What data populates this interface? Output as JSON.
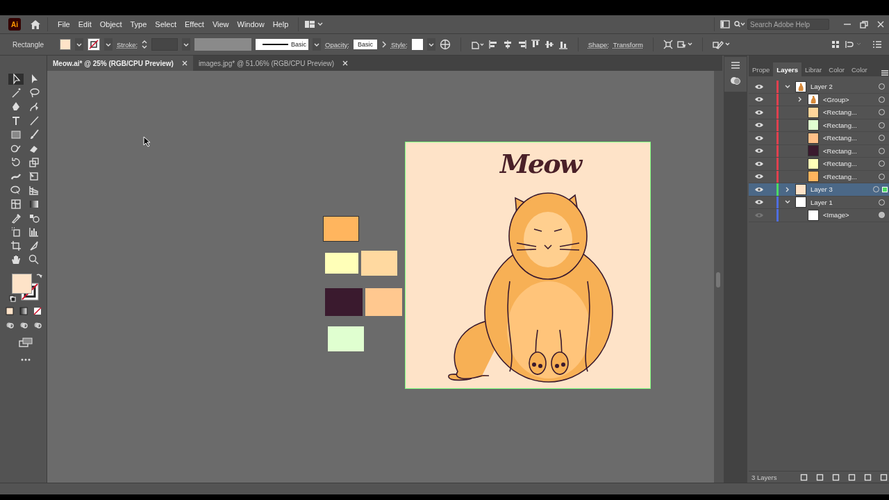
{
  "app": {
    "logo": "Ai"
  },
  "menu": [
    "File",
    "Edit",
    "Object",
    "Type",
    "Select",
    "Effect",
    "View",
    "Window",
    "Help"
  ],
  "search": {
    "placeholder": "Search Adobe Help"
  },
  "control_bar": {
    "tool": "Rectangle",
    "fill": {
      "color": "#fee3c8"
    },
    "stroke_label": "Stroke:",
    "stroke_profile": "Basic",
    "opacity_label": "Opacity:",
    "opacity_blend": "Basic",
    "style_label": "Style:",
    "shape_label": "Shape:",
    "transform_label": "Transform"
  },
  "document_tabs": [
    {
      "label": "Meow.ai* @ 25% (RGB/CPU Preview)",
      "selected": true
    },
    {
      "label": "images.jpg* @ 51.06% (RGB/CPU Preview)",
      "selected": false
    }
  ],
  "canvas": {
    "swatches": [
      {
        "color": "#ffb55e"
      },
      {
        "color": "#ffffb8"
      },
      {
        "color": "#ffd9a0"
      },
      {
        "color": "#3a1a2e"
      },
      {
        "color": "#ffc88f"
      },
      {
        "color": "#e0ffd0"
      }
    ],
    "artboard": {
      "color": "#fee3c8",
      "title": "Meow"
    }
  },
  "panel_tabs": [
    {
      "label": "Prope",
      "selected": false
    },
    {
      "label": "Layers",
      "selected": true
    },
    {
      "label": "Librar",
      "selected": false
    },
    {
      "label": "Color",
      "selected": false
    },
    {
      "label": "Color",
      "selected": false
    }
  ],
  "layers": [
    {
      "kind": "layer",
      "name": "Layer 2",
      "color": "#e0404f",
      "visible": true,
      "expanded": true,
      "selected": false,
      "children": [
        {
          "kind": "group",
          "name": "<Group>",
          "visible": true,
          "expanded": false,
          "selected": false
        },
        {
          "kind": "rect",
          "name": "<Rectang...",
          "color": "#ffd59a",
          "visible": true,
          "selected": false
        },
        {
          "kind": "rect",
          "name": "<Rectang...",
          "color": "#e0ffd0",
          "visible": true,
          "selected": false
        },
        {
          "kind": "rect",
          "name": "<Rectang...",
          "color": "#ffc088",
          "visible": true,
          "selected": false
        },
        {
          "kind": "rect",
          "name": "<Rectang...",
          "color": "#3a1a2e",
          "visible": true,
          "selected": false
        },
        {
          "kind": "rect",
          "name": "<Rectang...",
          "color": "#ffffb8",
          "visible": true,
          "selected": false
        },
        {
          "kind": "rect",
          "name": "<Rectang...",
          "color": "#ffb55e",
          "visible": true,
          "selected": false
        }
      ]
    },
    {
      "kind": "layer",
      "name": "Layer 3",
      "color": "#4cd964",
      "thumbnail": {
        "color": "#fee3c8"
      },
      "visible": true,
      "expanded": false,
      "selected": true
    },
    {
      "kind": "layer",
      "name": "Layer 1",
      "color": "#4f6ee0",
      "thumbnail": {
        "color": "#ffffff"
      },
      "visible": true,
      "expanded": true,
      "selected": false,
      "children": [
        {
          "kind": "image",
          "name": "<Image>",
          "visible": false,
          "selected": false
        }
      ]
    }
  ],
  "status_bar": {
    "layer_count": "3 Layers"
  }
}
